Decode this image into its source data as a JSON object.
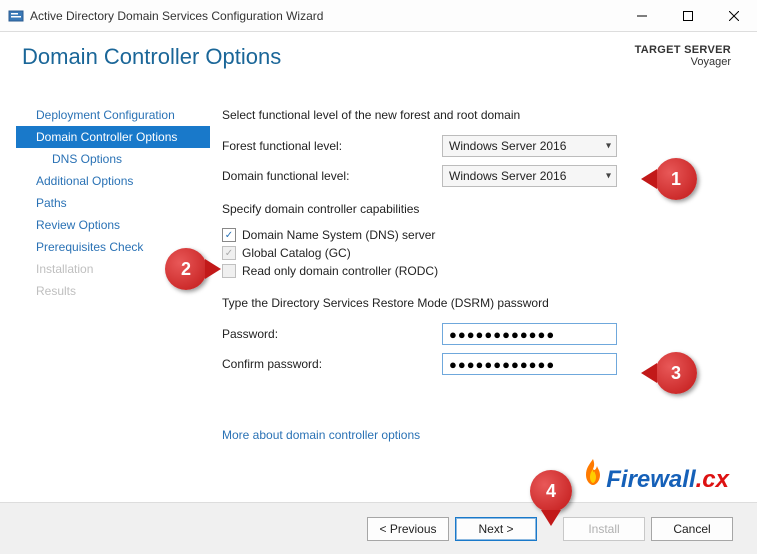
{
  "window_title": "Active Directory Domain Services Configuration Wizard",
  "header": {
    "page_title": "Domain Controller Options",
    "target_label": "TARGET SERVER",
    "target_value": "Voyager"
  },
  "sidebar": {
    "items": [
      {
        "label": "Deployment Configuration",
        "selected": false,
        "disabled": false,
        "indent": false
      },
      {
        "label": "Domain Controller Options",
        "selected": true,
        "disabled": false,
        "indent": false
      },
      {
        "label": "DNS Options",
        "selected": false,
        "disabled": false,
        "indent": true
      },
      {
        "label": "Additional Options",
        "selected": false,
        "disabled": false,
        "indent": false
      },
      {
        "label": "Paths",
        "selected": false,
        "disabled": false,
        "indent": false
      },
      {
        "label": "Review Options",
        "selected": false,
        "disabled": false,
        "indent": false
      },
      {
        "label": "Prerequisites Check",
        "selected": false,
        "disabled": false,
        "indent": false
      },
      {
        "label": "Installation",
        "selected": false,
        "disabled": true,
        "indent": false
      },
      {
        "label": "Results",
        "selected": false,
        "disabled": true,
        "indent": false
      }
    ]
  },
  "content": {
    "functional_level_heading": "Select functional level of the new forest and root domain",
    "forest_label": "Forest functional level:",
    "forest_value": "Windows Server 2016",
    "domain_label": "Domain functional level:",
    "domain_value": "Windows Server 2016",
    "capabilities_heading": "Specify domain controller capabilities",
    "cb_dns": "Domain Name System (DNS) server",
    "cb_gc": "Global Catalog (GC)",
    "cb_rodc": "Read only domain controller (RODC)",
    "dsrm_heading": "Type the Directory Services Restore Mode (DSRM) password",
    "password_label": "Password:",
    "password_value": "●●●●●●●●●●●●",
    "confirm_label": "Confirm password:",
    "confirm_value": "●●●●●●●●●●●●",
    "more_link": "More about domain controller options"
  },
  "footer": {
    "previous": "< Previous",
    "next": "Next >",
    "install": "Install",
    "cancel": "Cancel"
  },
  "logo": {
    "fw": "Firewall",
    "cx": ".cx"
  },
  "callouts": {
    "c1": "1",
    "c2": "2",
    "c3": "3",
    "c4": "4"
  }
}
